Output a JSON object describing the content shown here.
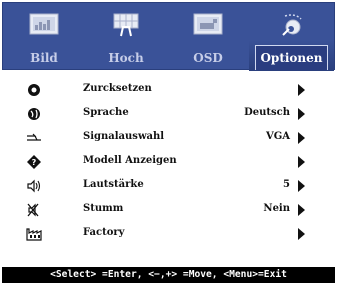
{
  "tabs": [
    {
      "label": "Bild",
      "icon": "picture-icon",
      "active": false
    },
    {
      "label": "Hoch",
      "icon": "position-icon",
      "active": false
    },
    {
      "label": "OSD",
      "icon": "osd-icon",
      "active": false
    },
    {
      "label": "Optionen",
      "icon": "options-icon",
      "active": true
    }
  ],
  "menu": {
    "items": [
      {
        "label": "Zurcksetzen",
        "value": "",
        "icon": "reset-icon"
      },
      {
        "label": "Sprache",
        "value": "Deutsch",
        "icon": "globe-icon"
      },
      {
        "label": "Signalauswahl",
        "value": "VGA",
        "icon": "signal-input-icon"
      },
      {
        "label": "Modell Anzeigen",
        "value": "",
        "icon": "info-diamond-icon"
      },
      {
        "label": "Lautstärke",
        "value": "5",
        "icon": "speaker-icon"
      },
      {
        "label": "Stumm",
        "value": "Nein",
        "icon": "mute-icon"
      },
      {
        "label": "Factory",
        "value": "",
        "icon": "factory-icon"
      }
    ]
  },
  "status_bar": "<Select> =Enter, <−,+> =Move, <Menu>=Exit",
  "colors": {
    "tabbar_bg": "#3a5298",
    "text": "#111111",
    "status_bg": "#000000"
  }
}
